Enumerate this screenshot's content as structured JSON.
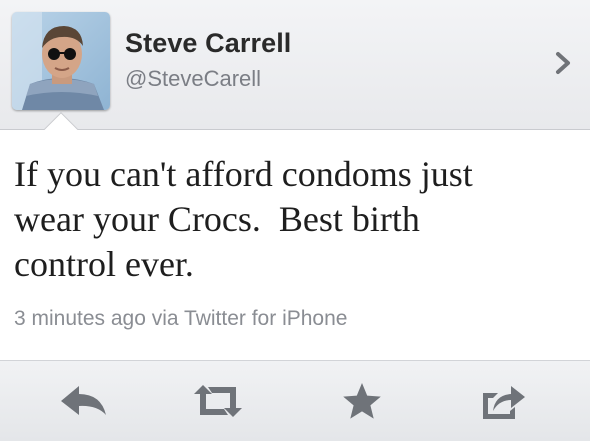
{
  "profile": {
    "name": "Steve Carrell",
    "handle": "@SteveCarell"
  },
  "tweet": {
    "text": "If you can't afford condoms just\nwear your Crocs.  Best birth\ncontrol ever.",
    "meta": "3 minutes ago via Twitter for iPhone"
  },
  "icons": {
    "profile_nav": "chevron-right-icon",
    "reply": "reply-icon",
    "retweet": "retweet-icon",
    "favorite": "star-icon",
    "share": "share-icon"
  },
  "colors": {
    "icon": "#6f7379",
    "name": "#2a2a2a",
    "handle": "#7b7e85"
  }
}
